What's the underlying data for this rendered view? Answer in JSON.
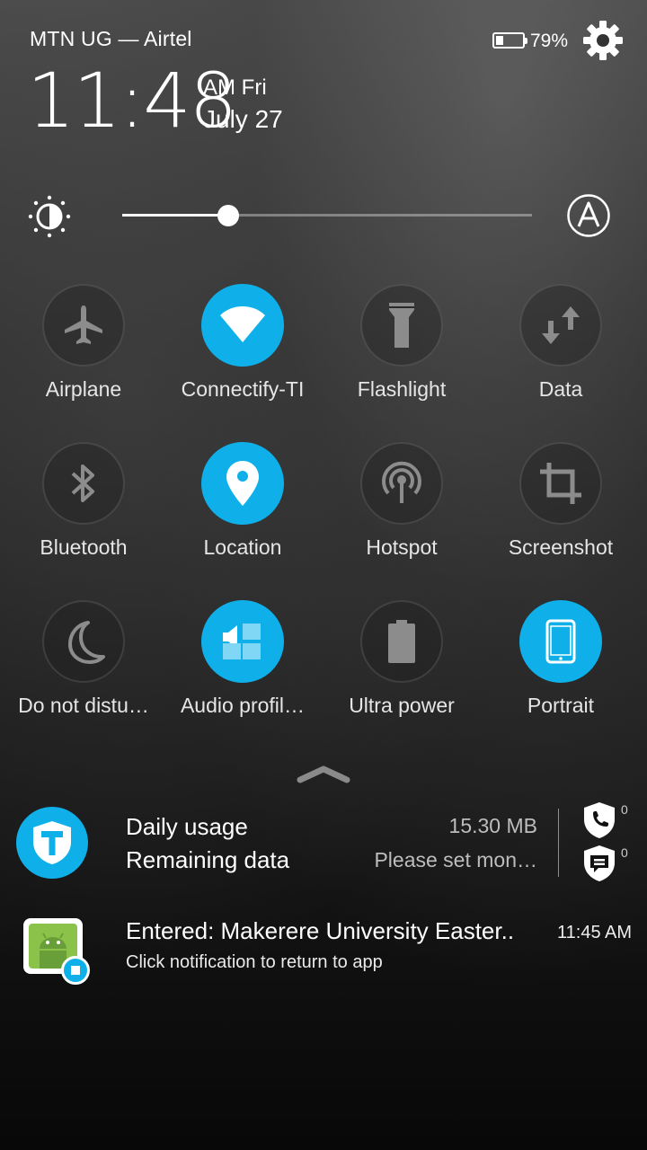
{
  "status_bar": {
    "carrier": "MTN UG — Airtel",
    "battery_percent": "79%",
    "battery_level": 0.79,
    "settings_icon": "gear-icon"
  },
  "clock": {
    "time": "11:48",
    "ampm_day": "AM Fri",
    "date": "July 27"
  },
  "brightness": {
    "level": 0.24,
    "icon": "brightness-icon",
    "auto_icon": "auto-brightness-icon"
  },
  "tiles": [
    {
      "label": "Airplane",
      "icon": "airplane-icon",
      "on": false
    },
    {
      "label": "Connectify-TI",
      "icon": "wifi-icon",
      "on": true
    },
    {
      "label": "Flashlight",
      "icon": "flashlight-icon",
      "on": false
    },
    {
      "label": "Data",
      "icon": "data-arrows-icon",
      "on": false
    },
    {
      "label": "Bluetooth",
      "icon": "bluetooth-icon",
      "on": false
    },
    {
      "label": "Location",
      "icon": "location-pin-icon",
      "on": true
    },
    {
      "label": "Hotspot",
      "icon": "hotspot-icon",
      "on": false
    },
    {
      "label": "Screenshot",
      "icon": "crop-icon",
      "on": false
    },
    {
      "label": "Do not distu…",
      "icon": "moon-icon",
      "on": false
    },
    {
      "label": "Audio profil…",
      "icon": "audio-profile-icon",
      "on": true
    },
    {
      "label": "Ultra power",
      "icon": "battery-icon",
      "on": false
    },
    {
      "label": "Portrait",
      "icon": "phone-portrait-icon",
      "on": true
    }
  ],
  "notifications": {
    "data_usage": {
      "daily_usage_label": "Daily usage",
      "daily_usage_value": "15.30 MB",
      "remaining_label": "Remaining data",
      "remaining_value": "Please set mon…",
      "call_block_count": "0",
      "sms_block_count": "0"
    },
    "geofence": {
      "title": "Entered: Makerere University Easter..",
      "time": "11:45 AM",
      "subtitle": "Click notification to return to app"
    }
  },
  "colors": {
    "accent": "#0fb0ea"
  }
}
